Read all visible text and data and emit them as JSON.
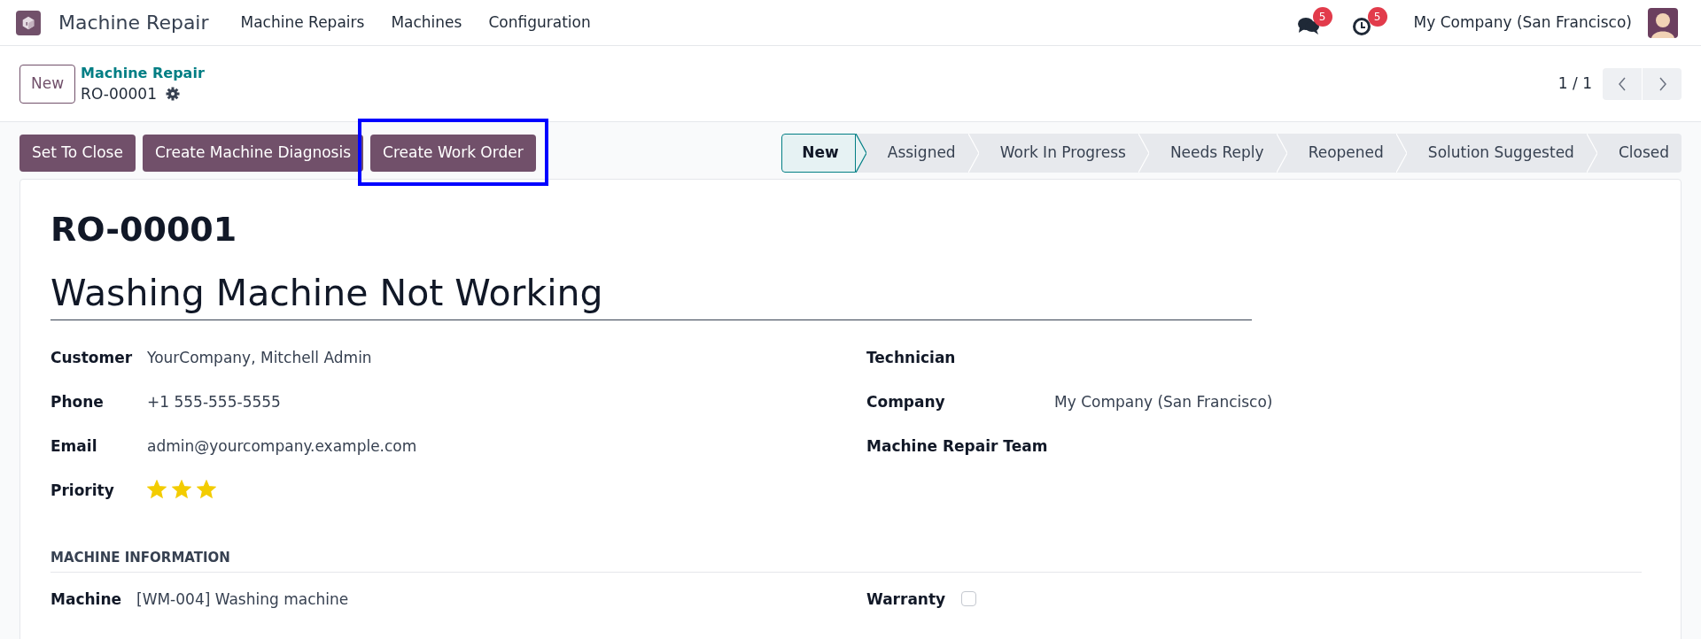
{
  "navbar": {
    "app_name": "Machine Repair",
    "menu": [
      "Machine Repairs",
      "Machines",
      "Configuration"
    ],
    "messages_badge": "5",
    "activities_badge": "5",
    "company": "My Company (San Francisco)"
  },
  "control_panel": {
    "new_button": "New",
    "breadcrumb": "Machine Repair",
    "record": "RO-00001",
    "pager": "1 / 1"
  },
  "action_buttons": [
    {
      "label": "Set To Close",
      "highlighted": false
    },
    {
      "label": "Create Machine Diagnosis",
      "highlighted": false
    },
    {
      "label": "Create Work Order",
      "highlighted": true
    }
  ],
  "stages": [
    {
      "label": "New",
      "selected": true
    },
    {
      "label": "Assigned",
      "selected": false
    },
    {
      "label": "Work In Progress",
      "selected": false
    },
    {
      "label": "Needs Reply",
      "selected": false
    },
    {
      "label": "Reopened",
      "selected": false
    },
    {
      "label": "Solution Suggested",
      "selected": false
    },
    {
      "label": "Closed",
      "selected": false
    }
  ],
  "form": {
    "reference": "RO-00001",
    "subject": "Washing Machine Not Working",
    "left_fields": [
      {
        "label": "Customer",
        "kind": "text",
        "value": "YourCompany, Mitchell Admin"
      },
      {
        "label": "Phone",
        "kind": "text",
        "value": "+1 555-555-5555"
      },
      {
        "label": "Email",
        "kind": "text",
        "value": "admin@yourcompany.example.com"
      },
      {
        "label": "Priority",
        "kind": "stars",
        "stars": 3
      }
    ],
    "right_fields": [
      {
        "label": "Technician",
        "kind": "text"
      },
      {
        "label": "Company",
        "kind": "text",
        "value": "My Company (San Francisco)"
      },
      {
        "label": "Machine Repair Team",
        "kind": "text"
      }
    ],
    "section": {
      "title": "MACHINE INFORMATION",
      "left_fields": [
        {
          "label": "Machine",
          "kind": "text",
          "value": "[WM-004] Washing machine"
        }
      ],
      "right_fields": [
        {
          "label": "Warranty",
          "kind": "checkbox",
          "checked": false
        }
      ]
    }
  }
}
